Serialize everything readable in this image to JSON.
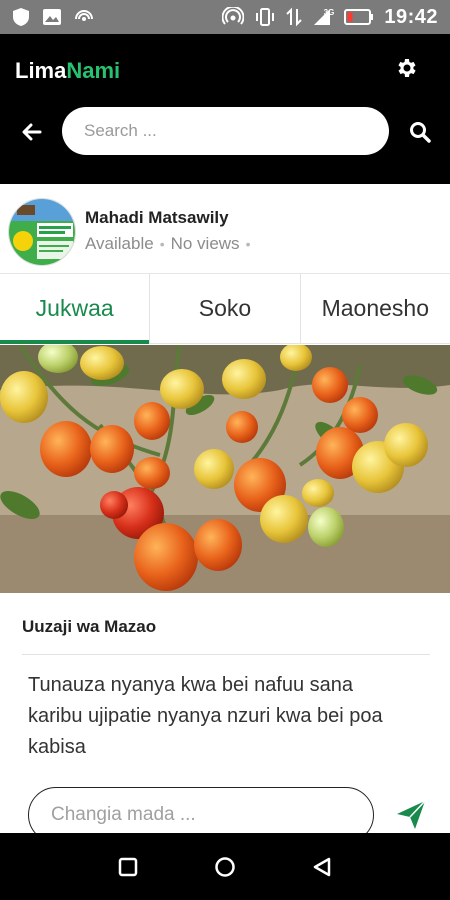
{
  "status_bar": {
    "time": "19:42",
    "network_badge": "3G",
    "left_icons": [
      "shield-icon",
      "image-icon",
      "nfc-icon"
    ],
    "right_icons": [
      "hotspot-icon",
      "vibrate-icon",
      "data-transfer-icon",
      "signal-icon",
      "battery-low-icon"
    ]
  },
  "header": {
    "brand_prefix": "Lima",
    "brand_suffix": "Nami",
    "brand_accent_color": "#27c270",
    "search_placeholder": "Search ..."
  },
  "profile": {
    "name": "Mahadi Matsawily",
    "status": "Available",
    "views": "No views"
  },
  "tabs": [
    {
      "label": "Jukwaa",
      "active": true
    },
    {
      "label": "Soko",
      "active": false
    },
    {
      "label": "Maonesho",
      "active": false
    }
  ],
  "post": {
    "title": "Uuzaji wa Mazao",
    "body": "Tunauza nyanya kwa bei nafuu sana karibu ujipatie nyanya nzuri kwa bei poa kabisa"
  },
  "comment": {
    "placeholder": "Changia mada ..."
  },
  "colors": {
    "primary_green": "#178a4c",
    "header_bg": "#000000",
    "status_bar_bg": "#7b7b7b"
  }
}
